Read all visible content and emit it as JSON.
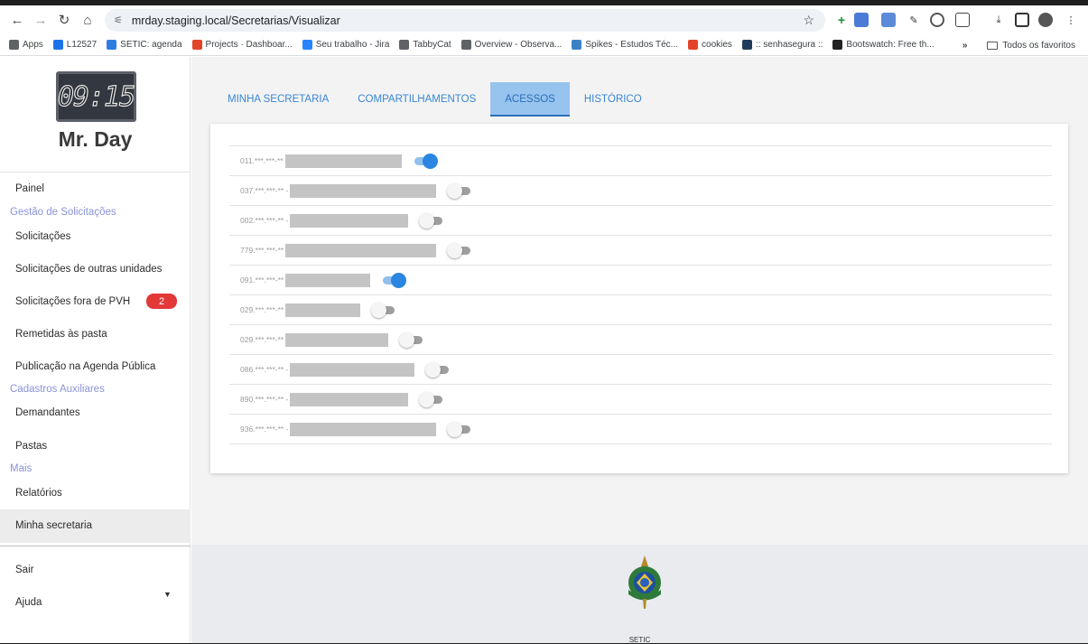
{
  "browser": {
    "url": "mrday.staging.local/Secretarias/Visualizar",
    "bookmarks": [
      {
        "label": "Apps",
        "color": "#5f6368"
      },
      {
        "label": "L12527",
        "color": "#1a73e8"
      },
      {
        "label": "SETIC: agenda",
        "color": "#2f7de1"
      },
      {
        "label": "Projects · Dashboar...",
        "color": "#e24329"
      },
      {
        "label": "Seu trabalho - Jira",
        "color": "#2684ff"
      },
      {
        "label": "TabbyCat",
        "color": "#5f6368"
      },
      {
        "label": "Overview - Observa...",
        "color": "#5f6368"
      },
      {
        "label": "Spikes - Estudos Téc...",
        "color": "#3b82c4"
      },
      {
        "label": "cookies",
        "color": "#e24329"
      },
      {
        "label": ":: senhasegura ::",
        "color": "#1f3b5c"
      },
      {
        "label": "Bootswatch: Free th...",
        "color": "#222222"
      }
    ],
    "bookmarks_more": "»",
    "all_bookmarks": "Todos os favoritos"
  },
  "sidebar": {
    "logo_clock": "09:15",
    "logo_text": "Mr. Day",
    "painel": "Painel",
    "section_gestao": "Gestão de Solicitações",
    "solicitacoes": "Solicitações",
    "solicitacoes_outras": "Solicitações de outras unidades",
    "solicitacoes_fora": "Solicitações fora de PVH",
    "solicitacoes_fora_badge": "2",
    "remetidas": "Remetidas às pasta",
    "publicacao": "Publicação na Agenda Pública",
    "section_cadastros": "Cadastros Auxiliares",
    "demandantes": "Demandantes",
    "pastas": "Pastas",
    "section_mais": "Mais",
    "relatorios": "Relatórios",
    "minha_secretaria": "Minha secretaria",
    "sair": "Sair",
    "ajuda": "Ajuda"
  },
  "tabs": [
    {
      "label": "MINHA SECRETARIA",
      "active": false
    },
    {
      "label": "COMPARTILHAMENTOS",
      "active": false
    },
    {
      "label": "ACESSOS",
      "active": true
    },
    {
      "label": "HISTÓRICO",
      "active": false
    }
  ],
  "access_rows": [
    {
      "cpf": "011.***.***-**",
      "redacted_fraction": 0.76,
      "enabled": true
    },
    {
      "cpf": "037.***.***-** -",
      "redacted_fraction": 0.95,
      "enabled": false
    },
    {
      "cpf": "002.***.***-** -",
      "redacted_fraction": 0.77,
      "enabled": false
    },
    {
      "cpf": "779.***.***-**",
      "redacted_fraction": 0.98,
      "enabled": false
    },
    {
      "cpf": "091.***.***-**",
      "redacted_fraction": 0.55,
      "enabled": true
    },
    {
      "cpf": "029.***.***-**",
      "redacted_fraction": 0.49,
      "enabled": false
    },
    {
      "cpf": "029.***.***-**",
      "redacted_fraction": 0.67,
      "enabled": false
    },
    {
      "cpf": "086.***.***-** -",
      "redacted_fraction": 0.81,
      "enabled": false
    },
    {
      "cpf": "890.***.***-** -",
      "redacted_fraction": 0.77,
      "enabled": false
    },
    {
      "cpf": "936.***.***-** -",
      "redacted_fraction": 0.95,
      "enabled": false
    }
  ],
  "footer": {
    "label": "SETIC"
  },
  "colors": {
    "accent": "#2a86e0",
    "section": "#8a93d9",
    "badge": "#e33838"
  }
}
